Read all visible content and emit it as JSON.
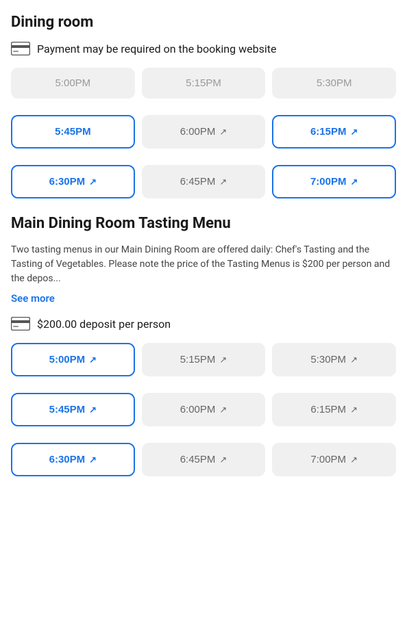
{
  "dining_room": {
    "title": "Dining room",
    "payment_notice": "Payment may be required on the booking website",
    "time_slots_row1": [
      {
        "time": "5:00PM",
        "state": "unavailable",
        "external": false
      },
      {
        "time": "5:15PM",
        "state": "unavailable",
        "external": false
      },
      {
        "time": "5:30PM",
        "state": "unavailable",
        "external": false
      }
    ],
    "time_slots_row2": [
      {
        "time": "5:45PM",
        "state": "available-blue",
        "external": false
      },
      {
        "time": "6:00PM",
        "state": "available-gray",
        "external": true
      },
      {
        "time": "6:15PM",
        "state": "available-blue",
        "external": true
      }
    ],
    "time_slots_row3": [
      {
        "time": "6:30PM",
        "state": "available-blue",
        "external": true
      },
      {
        "time": "6:45PM",
        "state": "available-gray",
        "external": true
      },
      {
        "time": "7:00PM",
        "state": "available-blue",
        "external": true
      }
    ]
  },
  "tasting_menu": {
    "title": "Main Dining Room Tasting Menu",
    "description": "Two tasting menus in our Main Dining Room are offered daily: Chef's Tasting and the Tasting of Vegetables. Please note the price of the Tasting Menus is $200 per person and the depos...",
    "see_more_label": "See more",
    "deposit_notice": "$200.00 deposit per person",
    "time_slots_row1": [
      {
        "time": "5:00PM",
        "state": "available-blue",
        "external": true
      },
      {
        "time": "5:15PM",
        "state": "available-gray",
        "external": true
      },
      {
        "time": "5:30PM",
        "state": "available-gray",
        "external": true
      }
    ],
    "time_slots_row2": [
      {
        "time": "5:45PM",
        "state": "available-blue",
        "external": true
      },
      {
        "time": "6:00PM",
        "state": "available-gray",
        "external": true
      },
      {
        "time": "6:15PM",
        "state": "available-gray",
        "external": true
      }
    ],
    "time_slots_row3": [
      {
        "time": "6:30PM",
        "state": "available-blue",
        "external": true
      },
      {
        "time": "6:45PM",
        "state": "available-gray",
        "external": true
      },
      {
        "time": "7:00PM",
        "state": "available-gray",
        "external": true
      }
    ]
  },
  "icons": {
    "credit_card": "💳",
    "external_link": "⬡"
  }
}
